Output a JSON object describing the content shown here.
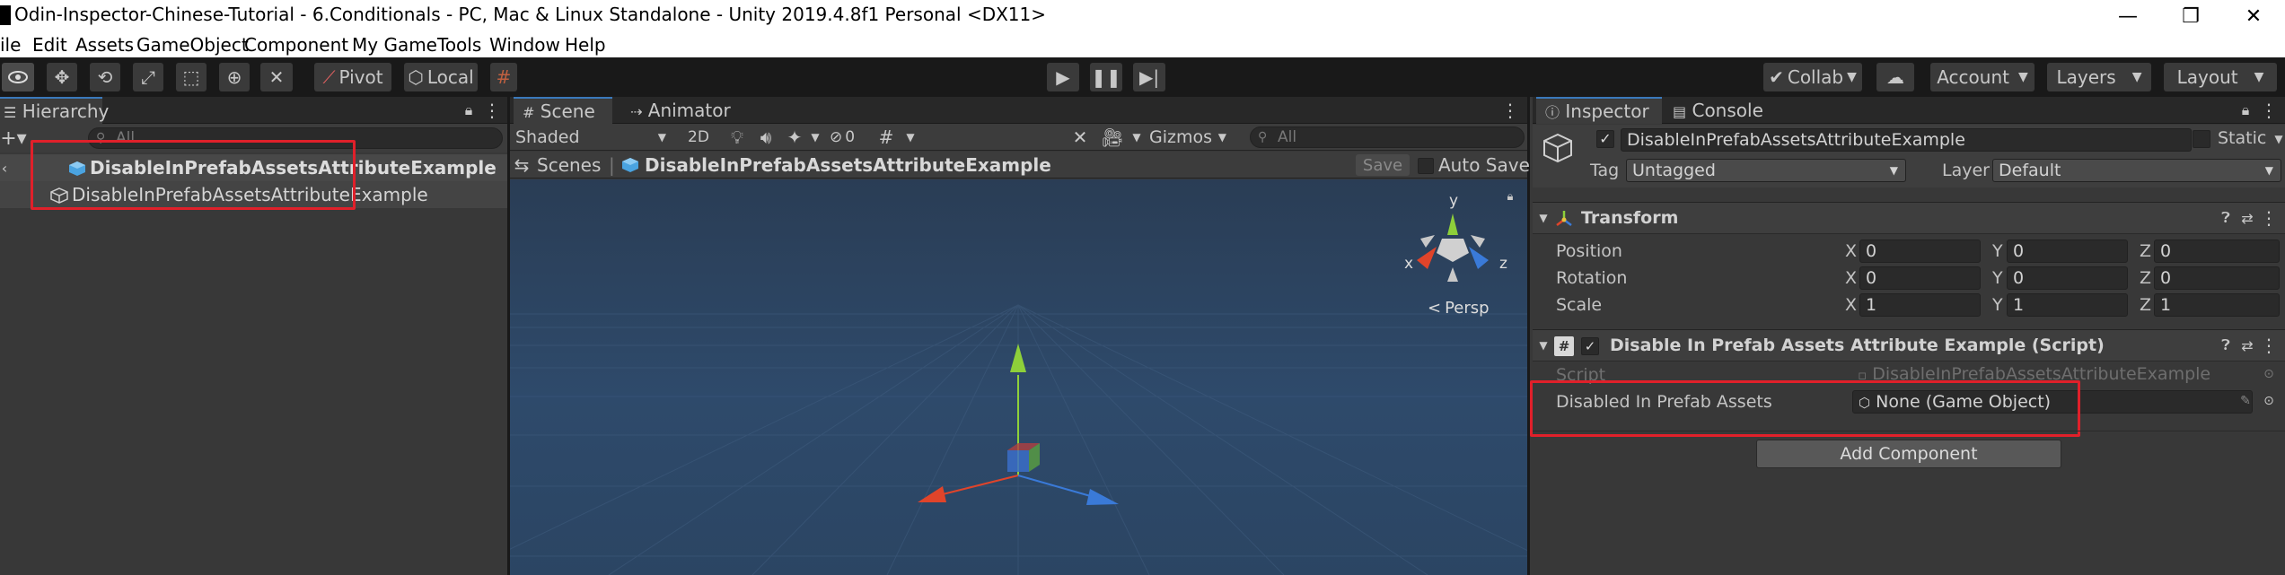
{
  "window": {
    "title": "Odin-Inspector-Chinese-Tutorial - 6.Conditionals - PC, Mac & Linux Standalone - Unity 2019.4.8f1 Personal <DX11>",
    "minimize_glyph": "—",
    "maximize_glyph": "❐",
    "close_glyph": "✕"
  },
  "menu": [
    "ile",
    "Edit",
    "Assets",
    "GameObject",
    "Component",
    "My Game",
    "Tools",
    "Window",
    "Help"
  ],
  "toolbar": {
    "pivot_label": "Pivot",
    "local_label": "Local",
    "collab_label": "Collab",
    "account_label": "Account",
    "layers_label": "Layers",
    "layout_label": "Layout"
  },
  "hierarchy": {
    "tab_label": "Hierarchy",
    "search_placeholder": "All",
    "scene_root": "DisableInPrefabAssetsAttributeExample",
    "child_item": "DisableInPrefabAssetsAttributeExample"
  },
  "scene": {
    "tab_scene": "Scene",
    "tab_animator": "Animator",
    "shading_mode": "Shaded",
    "mode_2d": "2D",
    "hidden_count": "0",
    "gizmos_label": "Gizmos",
    "search_placeholder": "All",
    "breadcrumb_scenes": "Scenes",
    "breadcrumb_prefab": "DisableInPrefabAssetsAttributeExample",
    "save_label": "Save",
    "auto_save_label": "Auto Save",
    "axis_y": "y",
    "axis_x": "x",
    "axis_z": "z",
    "persp_label": "Persp",
    "background_color": "#2e4a6b"
  },
  "inspector": {
    "tab_inspector": "Inspector",
    "tab_console": "Console",
    "object_name": "DisableInPrefabAssetsAttributeExample",
    "static_label": "Static",
    "tag_label": "Tag",
    "tag_value": "Untagged",
    "layer_label": "Layer",
    "layer_value": "Default",
    "transform": {
      "title": "Transform",
      "rows": [
        {
          "label": "Position",
          "x": "0",
          "y": "0",
          "z": "0"
        },
        {
          "label": "Rotation",
          "x": "0",
          "y": "0",
          "z": "0"
        },
        {
          "label": "Scale",
          "x": "1",
          "y": "1",
          "z": "1"
        }
      ],
      "axis_x": "X",
      "axis_y": "Y",
      "axis_z": "Z"
    },
    "script_component": {
      "title": "Disable In Prefab Assets Attribute Example (Script)",
      "script_label": "Script",
      "script_value": "DisableInPrefabAssetsAttributeExample",
      "field_label": "Disabled In Prefab Assets",
      "field_value": "None (Game Object)"
    },
    "add_component_label": "Add Component"
  },
  "colors": {
    "highlight": "#e0202a",
    "accent_blue": "#3a79bb"
  }
}
